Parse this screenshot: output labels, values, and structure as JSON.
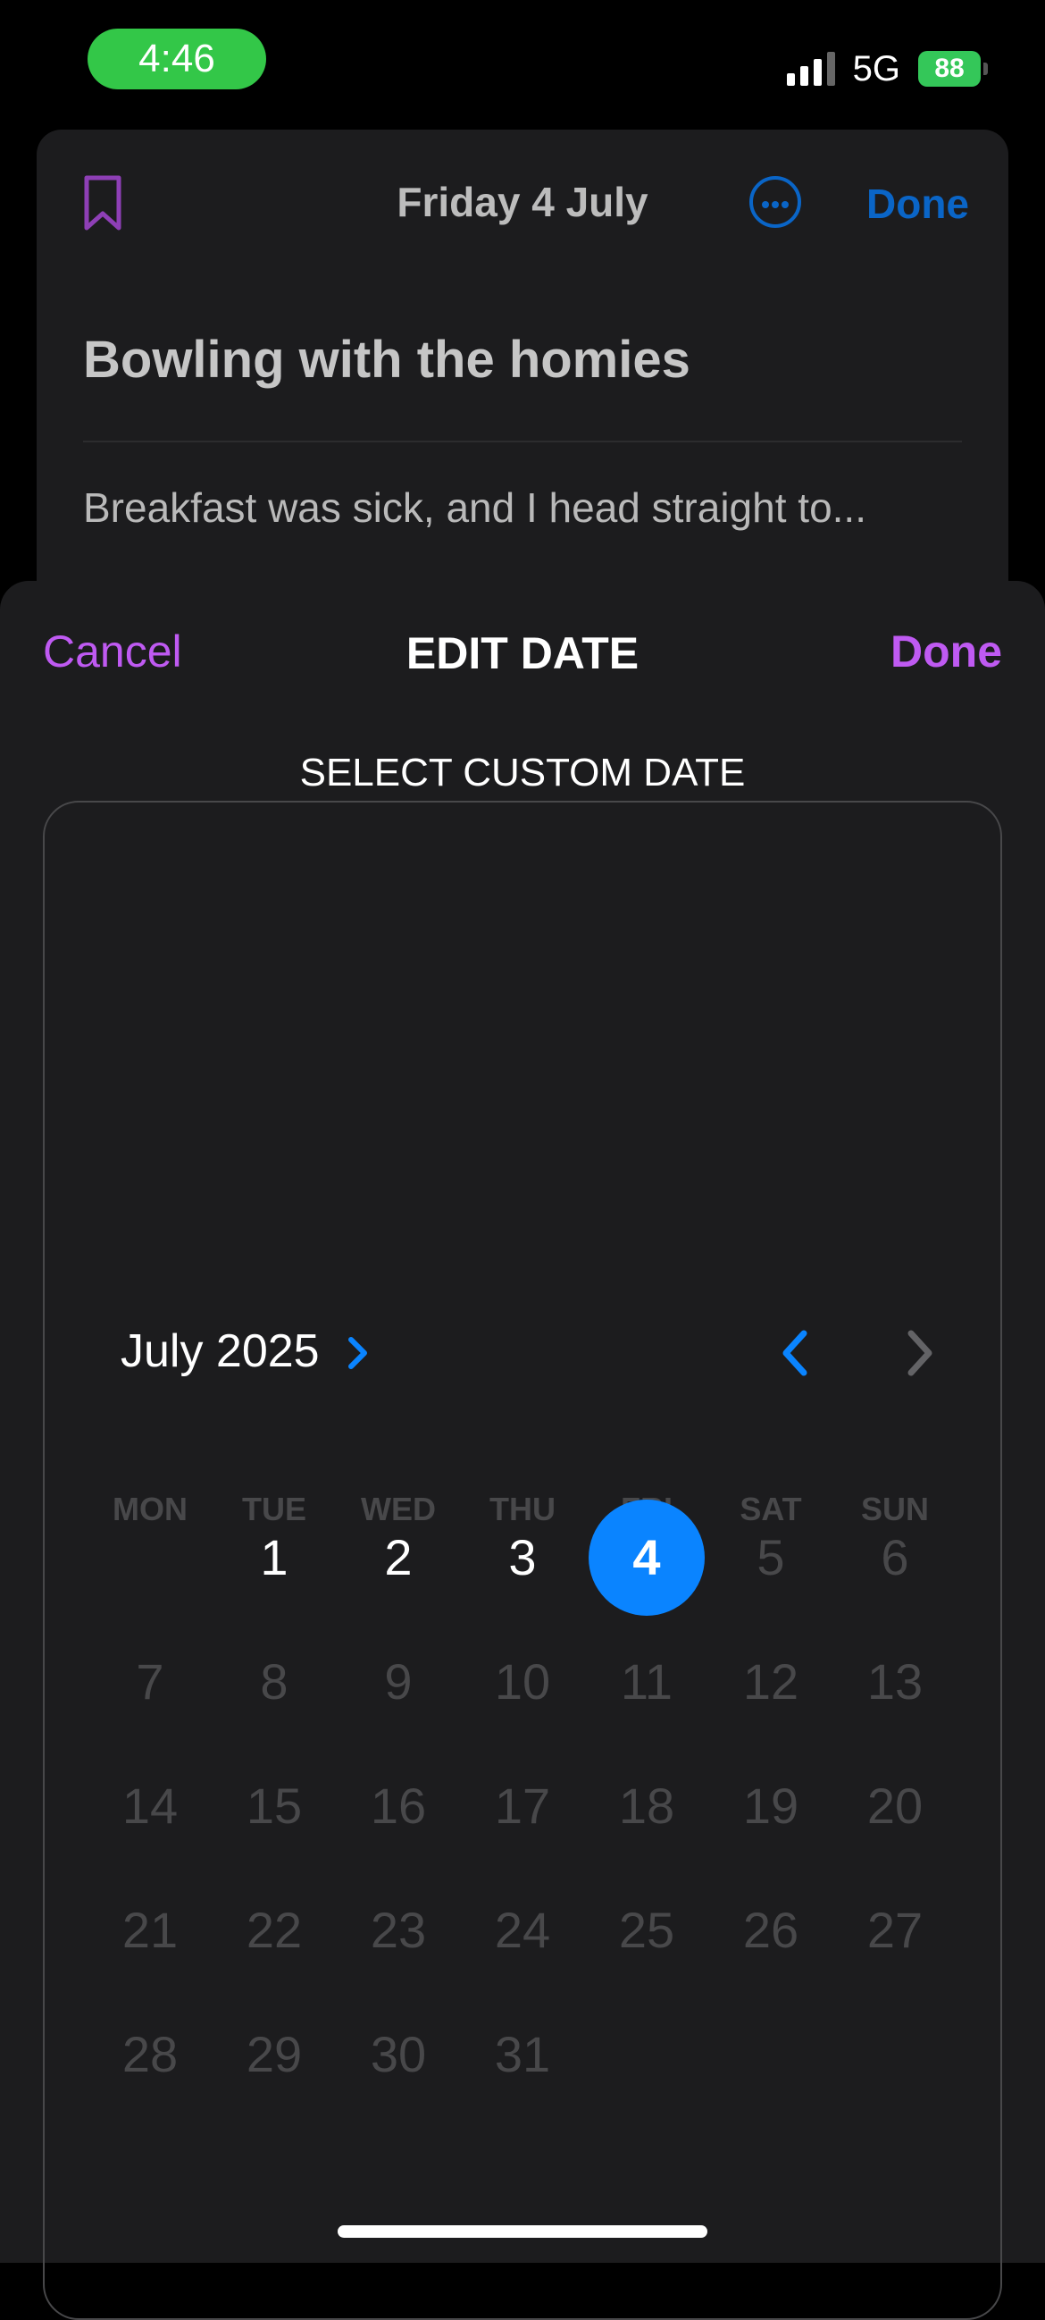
{
  "status_bar": {
    "time": "4:46",
    "network": "5G",
    "battery": "88"
  },
  "note": {
    "date": "Friday 4 July",
    "done_label": "Done",
    "title": "Bowling with the homies",
    "snippet": "Breakfast was sick, and I head straight to..."
  },
  "sheet": {
    "cancel_label": "Cancel",
    "title": "EDIT DATE",
    "done_label": "Done",
    "section_label": "SELECT CUSTOM DATE"
  },
  "calendar": {
    "month_label": "July 2025",
    "weekdays": [
      "MON",
      "TUE",
      "WED",
      "THU",
      "FRI",
      "SAT",
      "SUN"
    ],
    "first_weekday_index": 1,
    "days_in_month": 31,
    "selected_day": 4,
    "last_enabled_day": 4
  },
  "colors": {
    "accent_purple": "#bf5af2",
    "accent_blue": "#0a84ff",
    "status_green": "#33c748"
  },
  "icons": {
    "bookmark": "bookmark-icon",
    "more": "ellipsis-circle-icon",
    "month_chevron": "chevron-right-icon",
    "prev": "chevron-left-icon",
    "next": "chevron-right-icon"
  }
}
